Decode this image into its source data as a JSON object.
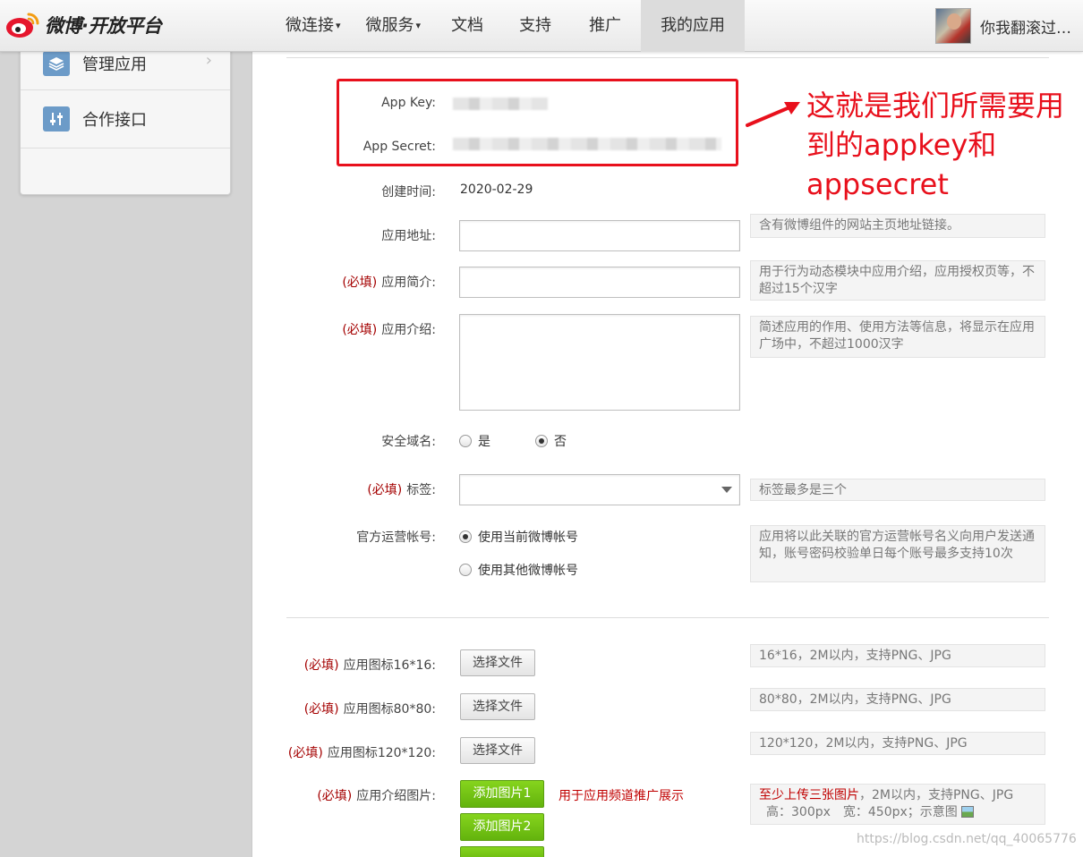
{
  "header": {
    "logo_text": "微博·开放平台",
    "nav": [
      {
        "label": "微连接",
        "dropdown": true
      },
      {
        "label": "微服务",
        "dropdown": true
      },
      {
        "label": "文档",
        "dropdown": false
      },
      {
        "label": "支持",
        "dropdown": false
      },
      {
        "label": "推广",
        "dropdown": false
      },
      {
        "label": "我的应用",
        "dropdown": false,
        "active": true
      }
    ],
    "caret": "▾",
    "user_name": "你我翻滚过…"
  },
  "sidebar": {
    "items": [
      {
        "label": "管理应用",
        "icon": "layers-icon"
      },
      {
        "label": "合作接口",
        "icon": "sliders-icon"
      }
    ]
  },
  "form": {
    "app_key_label": "App Key:",
    "app_secret_label": "App Secret:",
    "created_label": "创建时间:",
    "created_value": "2020-02-29",
    "required_mark": "(必填)",
    "app_url_label": "应用地址:",
    "app_url_hint": "含有微博组件的网站主页地址链接。",
    "summary_label": "应用简介:",
    "summary_hint": "用于行为动态模块中应用介绍，应用授权页等，不超过15个汉字",
    "intro_label": "应用介绍:",
    "intro_hint": "简述应用的作用、使用方法等信息，将显示在应用广场中，不超过1000汉字",
    "secure_domain_label": "安全域名:",
    "secure_yes": "是",
    "secure_no": "否",
    "tags_label": "标签:",
    "tags_hint": "标签最多是三个",
    "official_account_label": "官方运营帐号:",
    "official_opt1": "使用当前微博帐号",
    "official_opt2": "使用其他微博帐号",
    "official_hint": "应用将以此关联的官方运营帐号名义向用户发送通知，账号密码校验单日每个账号最多支持10次",
    "icon16_label": "应用图标16*16:",
    "icon16_hint": "16*16，2M以内，支持PNG、JPG",
    "icon80_label": "应用图标80*80:",
    "icon80_hint": "80*80，2M以内，支持PNG、JPG",
    "icon120_label": "应用图标120*120:",
    "icon120_hint": "120*120，2M以内，支持PNG、JPG",
    "choose_file": "选择文件",
    "intro_images_label": "应用介绍图片:",
    "add_image_1": "添加图片1",
    "add_image_2": "添加图片2",
    "promo_note": "用于应用频道推广展示",
    "images_hint_red": "至少上传三张图片",
    "images_hint_rest": "，2M以内，支持PNG、JPG",
    "images_hint_size": "高：300px　宽：450px；示意图"
  },
  "annotation": "这就是我们所需要用到的appkey和appsecret",
  "watermark": "https://blog.csdn.net/qq_40065776",
  "colors": {
    "annotation_red": "#e8101c",
    "required_red": "#a40000",
    "button_green": "#74c417",
    "weibo_red": "#e6162d"
  }
}
